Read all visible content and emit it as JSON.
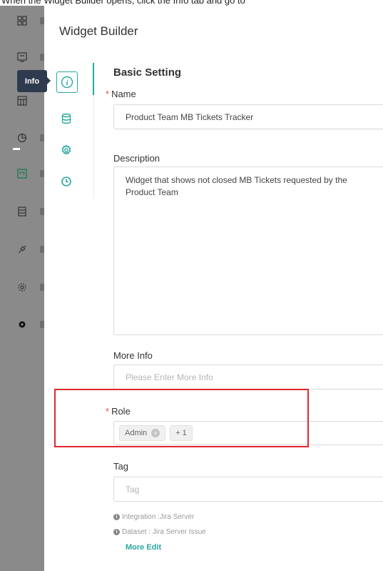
{
  "instruction": "When the Widget Builder opens, click the Info tab and go to",
  "panel": {
    "title": "Widget Builder"
  },
  "tabs": {
    "tooltip": "Info"
  },
  "form": {
    "section_title": "Basic Setting",
    "name": {
      "label": "Name",
      "required_mark": "*",
      "value": "Product Team MB Tickets Tracker"
    },
    "description": {
      "label": "Description",
      "value": "Widget that shows not closed MB Tickets requested by the Product Team"
    },
    "more_info": {
      "label": "More Info",
      "placeholder": "Please Enter More Info"
    },
    "role": {
      "label": "Role",
      "required_mark": "*",
      "chips": [
        "Admin",
        "+ 1"
      ],
      "chip_close": "×"
    },
    "tag": {
      "label": "Tag",
      "placeholder": "Tag"
    }
  },
  "meta": {
    "integration": "Integration :Jira Server",
    "dataset": "Dataset : Jira Server Issue",
    "more_edit": "More Edit",
    "info_glyph": "i"
  },
  "colors": {
    "accent": "#2aa8a0",
    "highlight": "#e0262e",
    "overlay": "#8a8a8a",
    "tooltip_bg": "#2e3a4d"
  }
}
